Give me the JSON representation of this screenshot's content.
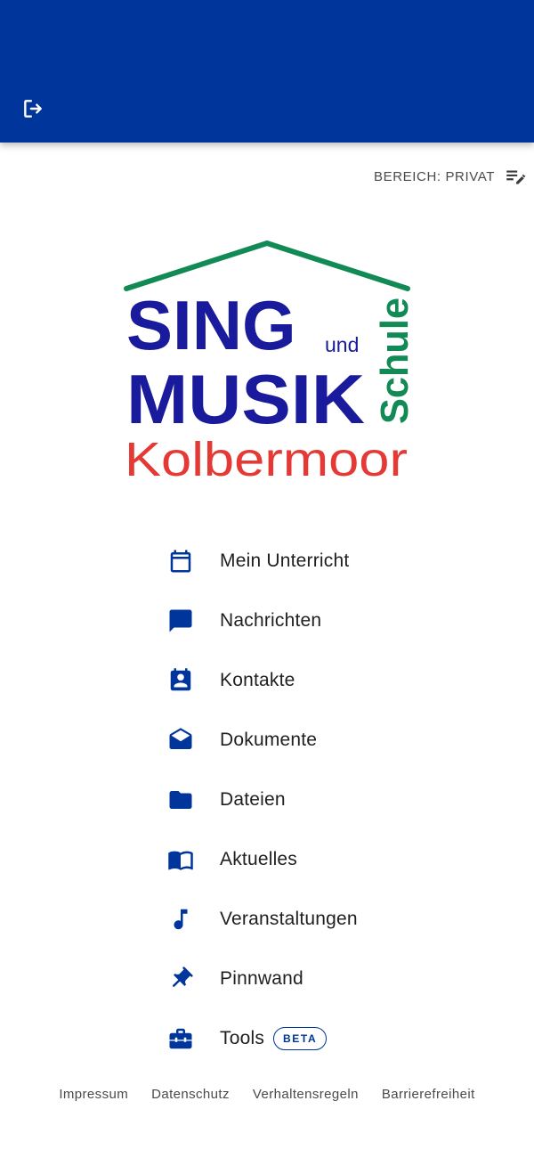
{
  "colors": {
    "primary": "#00359b",
    "logo_blue": "#1a1a9c",
    "logo_green": "#128a56",
    "logo_red": "#e53935"
  },
  "header": {
    "logout_icon": "logout-icon"
  },
  "area": {
    "label": "BEREICH: PRIVAT",
    "icon": "list-edit-icon"
  },
  "logo": {
    "line1": "SING",
    "connector": "und",
    "line2": "MUSIK",
    "vertical": "Schule",
    "line3": "Kolbermoor"
  },
  "menu": [
    {
      "label": "Mein Unterricht",
      "icon": "calendar-icon"
    },
    {
      "label": "Nachrichten",
      "icon": "chat-icon"
    },
    {
      "label": "Kontakte",
      "icon": "contacts-icon"
    },
    {
      "label": "Dokumente",
      "icon": "mail-open-icon"
    },
    {
      "label": "Dateien",
      "icon": "folder-icon"
    },
    {
      "label": "Aktuelles",
      "icon": "book-icon"
    },
    {
      "label": "Veranstaltungen",
      "icon": "music-note-icon"
    },
    {
      "label": "Pinnwand",
      "icon": "pin-icon"
    },
    {
      "label": "Tools",
      "icon": "toolbox-icon",
      "badge": "BETA"
    }
  ],
  "footer": [
    "Impressum",
    "Datenschutz",
    "Verhaltensregeln",
    "Barrierefreiheit"
  ]
}
